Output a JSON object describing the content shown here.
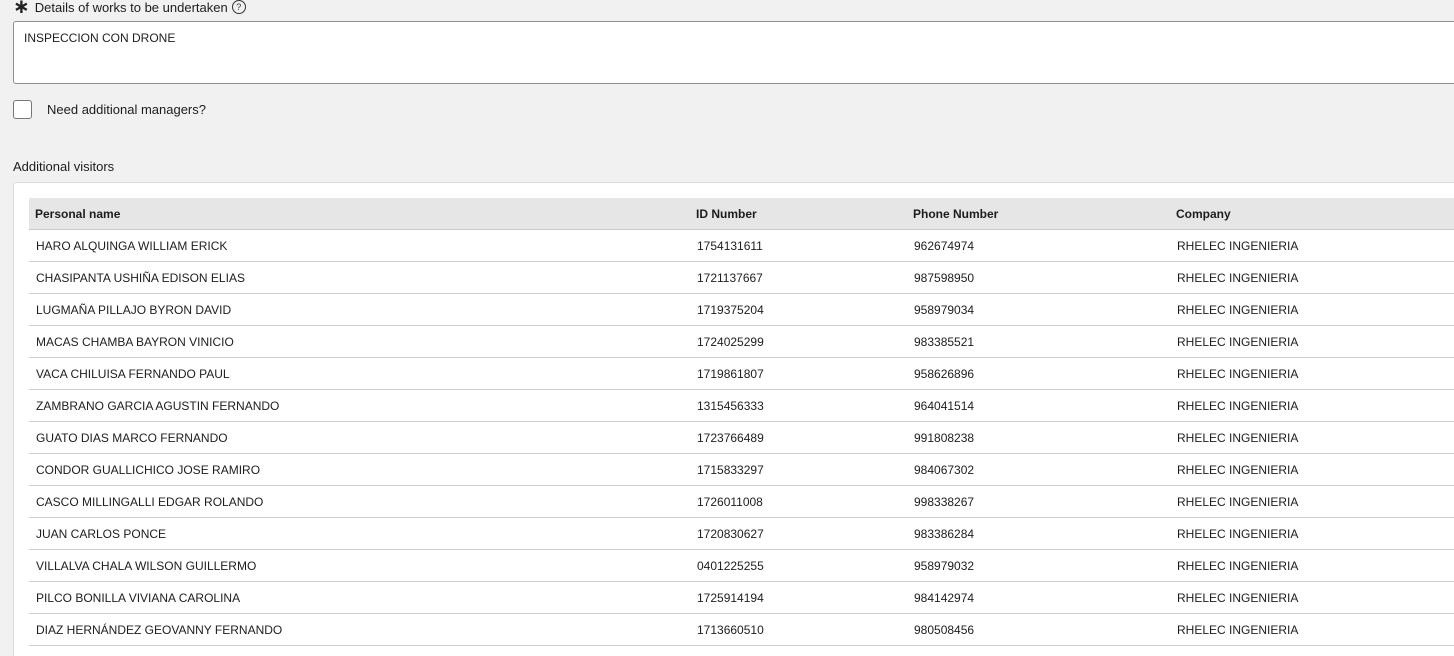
{
  "details_field": {
    "label": "Details of works to be undertaken",
    "required_icon": "asterisk-icon",
    "help_icon": "question-circle-icon",
    "help_glyph": "?",
    "value": "INSPECCION CON DRONE"
  },
  "managers_checkbox": {
    "label": "Need additional managers?",
    "checked": false
  },
  "visitors": {
    "section_label": "Additional visitors",
    "columns": [
      "Personal name",
      "ID Number",
      "Phone Number",
      "Company"
    ],
    "rows": [
      [
        "HARO ALQUINGA WILLIAM ERICK",
        "1754131611",
        "962674974",
        "RHELEC INGENIERIA"
      ],
      [
        "CHASIPANTA USHIÑA EDISON ELIAS",
        "1721137667",
        "987598950",
        "RHELEC INGENIERIA"
      ],
      [
        "LUGMAÑA PILLAJO BYRON DAVID",
        "1719375204",
        "958979034",
        "RHELEC INGENIERIA"
      ],
      [
        "MACAS CHAMBA BAYRON VINICIO",
        "1724025299",
        "983385521",
        "RHELEC INGENIERIA"
      ],
      [
        "VACA CHILUISA FERNANDO PAUL",
        "1719861807",
        "958626896",
        "RHELEC INGENIERIA"
      ],
      [
        "ZAMBRANO GARCIA AGUSTIN FERNANDO",
        "1315456333",
        "964041514",
        "RHELEC INGENIERIA"
      ],
      [
        "GUATO DIAS MARCO FERNANDO",
        "1723766489",
        "991808238",
        "RHELEC INGENIERIA"
      ],
      [
        "CONDOR GUALLICHICO JOSE RAMIRO",
        "1715833297",
        "984067302",
        "RHELEC INGENIERIA"
      ],
      [
        "CASCO MILLINGALLI EDGAR ROLANDO",
        "1726011008",
        "998338267",
        "RHELEC INGENIERIA"
      ],
      [
        "JUAN CARLOS PONCE",
        "1720830627",
        "983386284",
        "RHELEC INGENIERIA"
      ],
      [
        "VILLALVA CHALA WILSON GUILLERMO",
        "0401225255",
        "958979032",
        "RHELEC INGENIERIA"
      ],
      [
        "PILCO BONILLA VIVIANA CAROLINA",
        "1725914194",
        "984142974",
        "RHELEC INGENIERIA"
      ],
      [
        "DIAZ HERNÁNDEZ GEOVANNY FERNANDO",
        "1713660510",
        "980508456",
        "RHELEC INGENIERIA"
      ]
    ]
  }
}
